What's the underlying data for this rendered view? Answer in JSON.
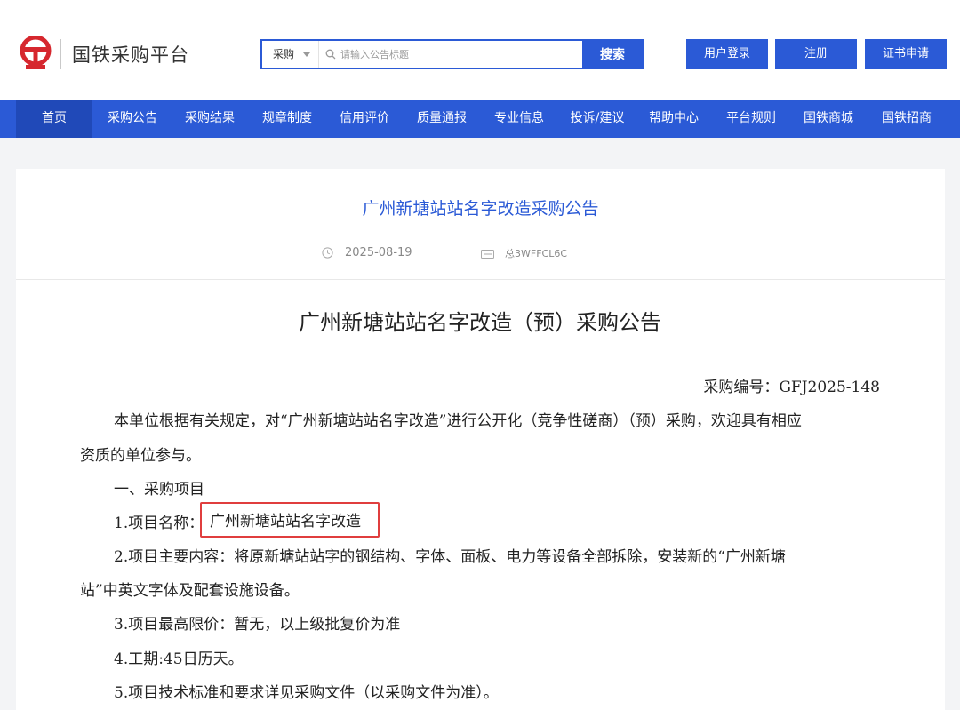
{
  "header": {
    "site_title": "国铁采购平台",
    "search": {
      "category": "采购",
      "placeholder": "请输入公告标题",
      "button": "搜索"
    },
    "buttons": [
      "用户登录",
      "注册",
      "证书申请"
    ],
    "brand_color": "#2b5ad6"
  },
  "nav": {
    "items": [
      "首页",
      "采购公告",
      "采购结果",
      "规章制度",
      "信用评价",
      "质量通报",
      "专业信息",
      "投诉/建议",
      "帮助中心",
      "平台规则",
      "国铁商城",
      "国铁招商"
    ],
    "active_index": 0
  },
  "article": {
    "header_title": "广州新塘站站名字改造采购公告",
    "date": "2025-08-19",
    "number": "总3WFFCL6C",
    "doc_title": "广州新塘站站名字改造（预）采购公告",
    "procurement_no": "采购编号：GFJ2025-148",
    "intro_line1": "本单位根据有关规定，对“广州新塘站站名字改造”进行公开化（竞争性磋商）（预）采购，欢迎具有相应",
    "intro_line2": "资质的单位参与。",
    "section1": "一、采购项目",
    "item1_label": "1.项目名称：",
    "item1_value": "广州新塘站站名字改造",
    "item2_line1": "2.项目主要内容：将原新塘站站字的钢结构、字体、面板、电力等设备全部拆除，安装新的“广州新塘",
    "item2_line2": "站”中英文字体及配套设施设备。",
    "item3": "3.项目最高限价：暂无，以上级批复价为准",
    "item4": "4.工期:45日历天。",
    "item5": "5.项目技术标准和要求详见采购文件（以采购文件为准）。",
    "highlight_color": "#e03e3e"
  }
}
